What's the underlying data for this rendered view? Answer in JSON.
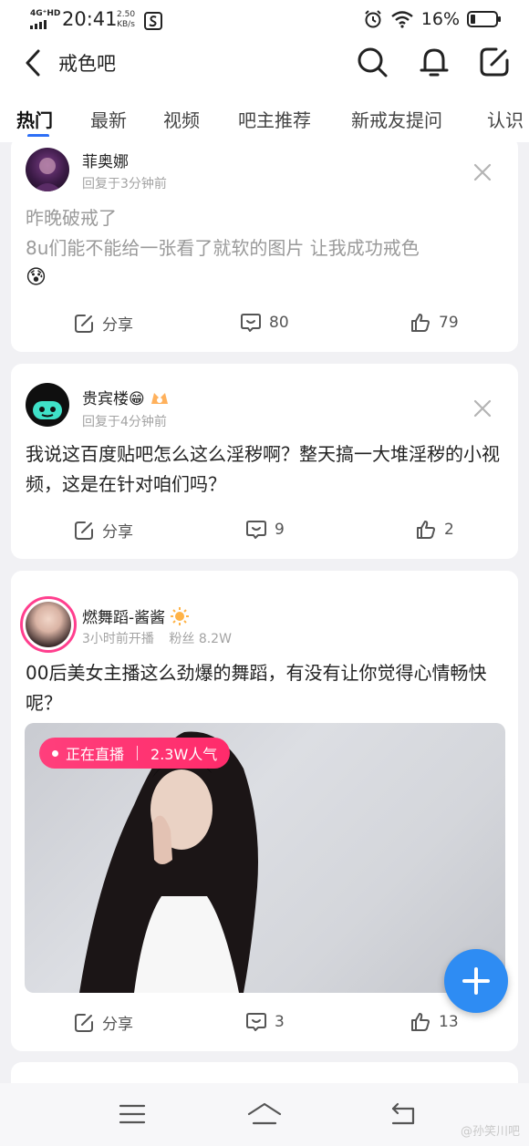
{
  "status_bar": {
    "network": "4G⁺HD",
    "time": "20:41",
    "speed_value": "2.50",
    "speed_unit": "KB/s",
    "battery": "16%"
  },
  "header": {
    "title": "戒色吧"
  },
  "tabs": [
    "热门",
    "最新",
    "视频",
    "吧主推荐",
    "新戒友提问",
    "认识"
  ],
  "posts": [
    {
      "username": "菲奥娜",
      "meta": "回复于3分钟前",
      "text_line1": "昨晚破戒了",
      "text_line2": "8u们能不能给一张看了就软的图片 让我成功戒色",
      "emoji": "😰",
      "share_label": "分享",
      "comments": "80",
      "likes": "79"
    },
    {
      "username": "贵宾楼😁",
      "meta": "回复于4分钟前",
      "text": "我说这百度贴吧怎么这么淫秽啊？整天搞一大堆淫秽的小视频，这是在针对咱们吗？",
      "share_label": "分享",
      "comments": "9",
      "likes": "2"
    },
    {
      "username": "燃舞蹈-酱酱",
      "meta_time": "3小时前开播",
      "meta_fans": "粉丝 8.2W",
      "text": "00后美女主播这么劲爆的舞蹈，有没有让你觉得心情畅快呢？",
      "live_label": "正在直播",
      "popularity": "2.3W人气",
      "share_label": "分享",
      "comments": "3",
      "likes": "13"
    }
  ],
  "watermark": "@孙笑川吧",
  "colors": {
    "accent": "#2d6ff6",
    "live_pink": "#ff2b6b",
    "fab_blue": "#2e8cf3"
  }
}
